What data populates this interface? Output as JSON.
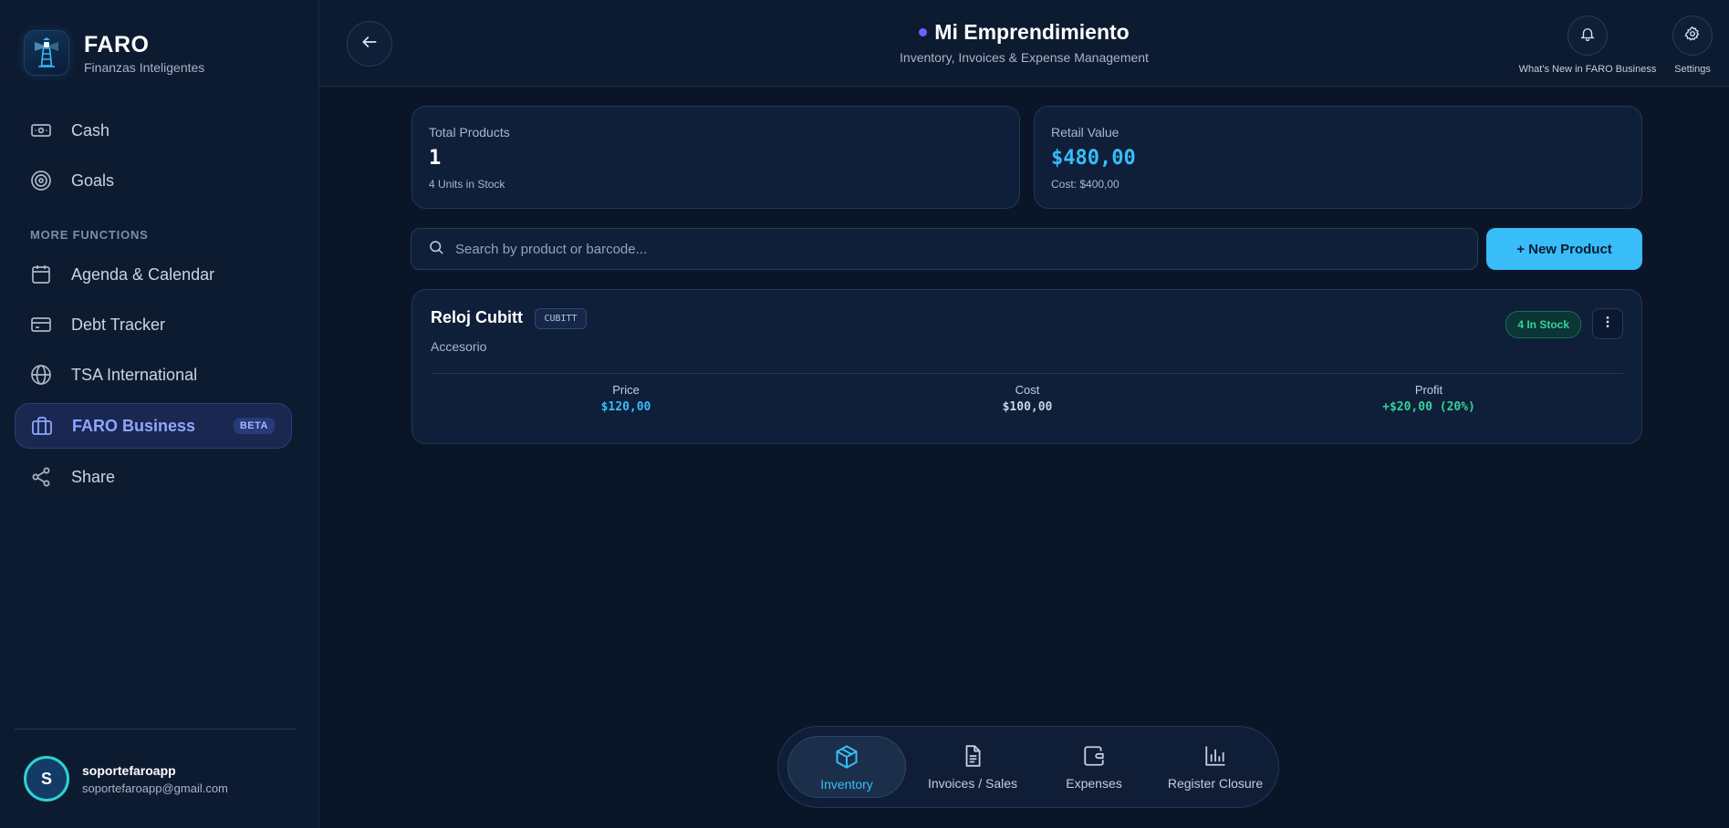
{
  "brand": {
    "name": "FARO",
    "tagline": "Finanzas Inteligentes"
  },
  "sidebar": {
    "items_top": [
      {
        "label": "Cash",
        "icon": "cash-icon"
      },
      {
        "label": "Goals",
        "icon": "target-icon"
      }
    ],
    "section_label": "MORE FUNCTIONS",
    "items_more": [
      {
        "label": "Agenda & Calendar",
        "icon": "calendar-icon"
      },
      {
        "label": "Debt Tracker",
        "icon": "credit-card-icon"
      },
      {
        "label": "TSA International",
        "icon": "globe-icon"
      },
      {
        "label": "FARO Business",
        "icon": "briefcase-icon",
        "badge": "BETA",
        "active": true
      },
      {
        "label": "Share",
        "icon": "share-icon"
      }
    ],
    "user": {
      "initial": "S",
      "name": "soportefaroapp",
      "email": "soportefaroapp@gmail.com"
    }
  },
  "header": {
    "title": "Mi Emprendimiento",
    "subtitle": "Inventory, Invoices & Expense Management",
    "whats_new_label": "What's New in FARO Business",
    "settings_label": "Settings"
  },
  "stats": {
    "total_products": {
      "label": "Total Products",
      "value": "1",
      "sub": "4 Units in Stock"
    },
    "retail_value": {
      "label": "Retail Value",
      "value": "$480,00",
      "sub": "Cost: $400,00"
    }
  },
  "search": {
    "placeholder": "Search by product or barcode...",
    "value": ""
  },
  "new_product_label": "+ New Product",
  "products": [
    {
      "name": "Reloj Cubitt",
      "sku": "CUBITT",
      "category": "Accesorio",
      "stock": "4 In Stock",
      "price_label": "Price",
      "price": "$120,00",
      "cost_label": "Cost",
      "cost": "$100,00",
      "profit_label": "Profit",
      "profit": "+$20,00 (20%)"
    }
  ],
  "bottom_nav": [
    {
      "label": "Inventory",
      "icon": "box-icon",
      "active": true
    },
    {
      "label": "Invoices / Sales",
      "icon": "document-icon"
    },
    {
      "label": "Expenses",
      "icon": "wallet-icon"
    },
    {
      "label": "Register Closure",
      "icon": "bar-chart-icon"
    }
  ],
  "colors": {
    "accent": "#38bdf8",
    "active_nav": "#8ea6ff",
    "profit": "#34d399",
    "background": "#0a1628"
  }
}
